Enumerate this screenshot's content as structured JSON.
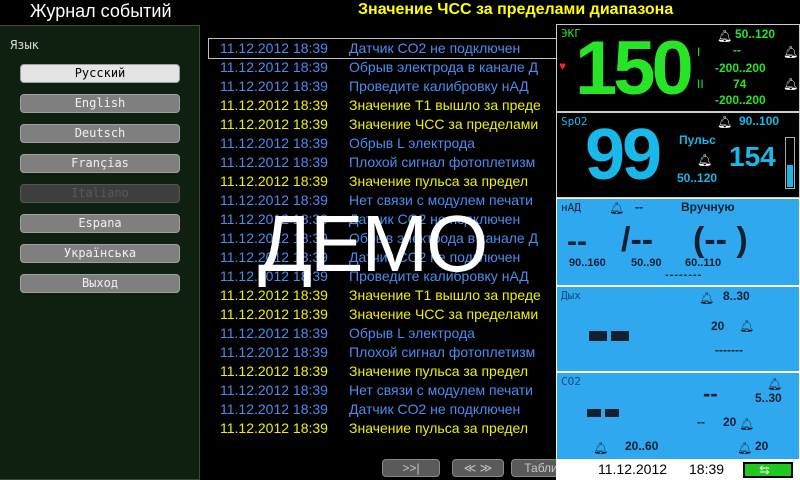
{
  "header": {
    "title": "Журнал событий",
    "alarm": "Значение ЧСС за пределами диапазона"
  },
  "language": {
    "heading": "Язык",
    "items": [
      {
        "label": "Русский",
        "state": "active"
      },
      {
        "label": "English",
        "state": "normal"
      },
      {
        "label": "Deutsch",
        "state": "normal"
      },
      {
        "label": "Françias",
        "state": "normal"
      },
      {
        "label": "Italiano",
        "state": "disabled"
      },
      {
        "label": "Espana",
        "state": "normal"
      },
      {
        "label": "Українська",
        "state": "normal"
      },
      {
        "label": "Выход",
        "state": "normal"
      }
    ]
  },
  "log": {
    "rows": [
      {
        "datetime": "11.12.2012 18:39",
        "message": "Датчик CO2 не подключен",
        "color": "blue",
        "selected": true
      },
      {
        "datetime": "11.12.2012 18:39",
        "message": "Обрыв электрода в канале Д",
        "color": "blue"
      },
      {
        "datetime": "11.12.2012 18:39",
        "message": "Проведите калибровку нАД",
        "color": "blue"
      },
      {
        "datetime": "11.12.2012 18:39",
        "message": "Значение T1 вышло за преде",
        "color": "yellow"
      },
      {
        "datetime": "11.12.2012 18:39",
        "message": "Значение ЧСС за пределами",
        "color": "yellow"
      },
      {
        "datetime": "11.12.2012 18:39",
        "message": "Обрыв L электрода",
        "color": "blue"
      },
      {
        "datetime": "11.12.2012 18:39",
        "message": "Плохой сигнал фотоплетизм",
        "color": "blue"
      },
      {
        "datetime": "11.12.2012 18:39",
        "message": "Значение пульса за предел",
        "color": "yellow"
      },
      {
        "datetime": "11.12.2012 18:39",
        "message": "Нет связи с модулем печати",
        "color": "blue"
      },
      {
        "datetime": "11.12.2012 18:39",
        "message": "Датчик CO2 не подключен",
        "color": "blue"
      },
      {
        "datetime": "11.12.2012 18:39",
        "message": "Обрыв электрода в канале Д",
        "color": "blue"
      },
      {
        "datetime": "11.12.2012 18:39",
        "message": "Датчик CO2 не подключен",
        "color": "blue"
      },
      {
        "datetime": "11.12.2012 18:39",
        "message": "Проведите калибровку нАД",
        "color": "blue"
      },
      {
        "datetime": "11.12.2012 18:39",
        "message": "Значение T1 вышло за преде",
        "color": "yellow"
      },
      {
        "datetime": "11.12.2012 18:39",
        "message": "Значение ЧСС за пределами",
        "color": "yellow"
      },
      {
        "datetime": "11.12.2012 18:39",
        "message": "Обрыв L электрода",
        "color": "blue"
      },
      {
        "datetime": "11.12.2012 18:39",
        "message": "Плохой сигнал фотоплетизм",
        "color": "blue"
      },
      {
        "datetime": "11.12.2012 18:39",
        "message": "Значение пульса за предел",
        "color": "yellow"
      },
      {
        "datetime": "11.12.2012 18:39",
        "message": "Нет связи с модулем печати",
        "color": "blue"
      },
      {
        "datetime": "11.12.2012 18:39",
        "message": "Датчик CO2 не подключен",
        "color": "blue"
      },
      {
        "datetime": "11.12.2012 18:39",
        "message": "Значение пульса за предел",
        "color": "yellow"
      }
    ]
  },
  "watermark": "ДЕМО",
  "nav": {
    "next": ">>|",
    "updown": "≪ ≫",
    "table": "Табли"
  },
  "vitals": {
    "ecg": {
      "label": "ЭКГ",
      "value": "150",
      "range": "50..120",
      "lead1": "I",
      "lead2": "II",
      "st1_value": "--",
      "st1_range": "-200..200",
      "st2_value": "74",
      "st2_range": "-200..200"
    },
    "spo2": {
      "label": "SpO2",
      "value": "99",
      "range": "90..100",
      "pulse_label": "Пульс",
      "pulse_value": "154",
      "pulse_range": "50..120"
    },
    "nibp": {
      "label": "нАД",
      "mode_value": "--",
      "mode": "Вручную",
      "sys": "--",
      "dia": "/--",
      "map": "(--  )",
      "sys_range": "90..160",
      "dia_range": "50..90",
      "map_range": "60..110",
      "time": "--------"
    },
    "resp": {
      "label": "Дых",
      "range": "8..30",
      "value2": "20",
      "dashes": "-------"
    },
    "co2": {
      "label": "CO2",
      "value": "--",
      "range": "5..30",
      "fico2": "--",
      "fico2_range": "20",
      "rate_dash": "--",
      "rate_range": "20..60",
      "rate": "20"
    }
  },
  "status": {
    "date": "11.12.2012",
    "time": "18:39"
  },
  "colors": {
    "blue_text": "#4a8cf0",
    "yellow_text": "#f0f000",
    "ecg_green": "#27e427",
    "spo2_cyan": "#18b8e8",
    "panel_blue": "#30a8f0"
  }
}
